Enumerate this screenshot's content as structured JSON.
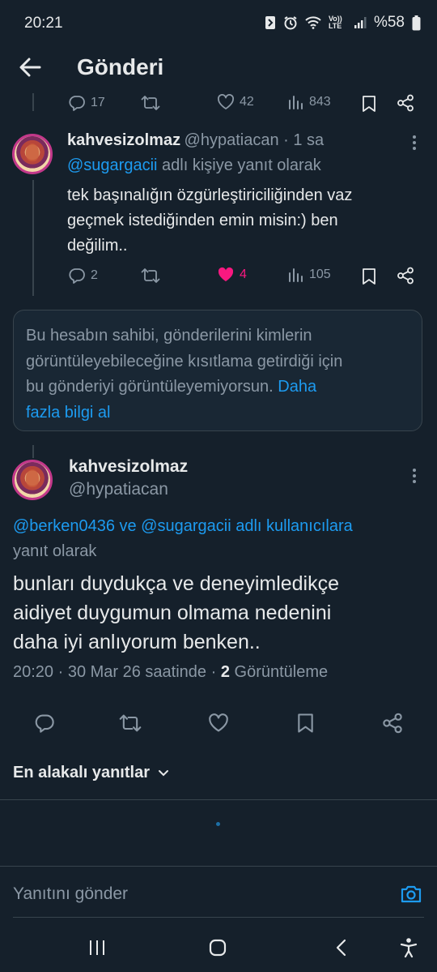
{
  "status_bar": {
    "time": "20:21",
    "battery": "%58",
    "volte": "Vo)) LTE"
  },
  "header": {
    "title": "Gönderi"
  },
  "prev_tweet_actions": {
    "replies": "17",
    "likes": "42",
    "views": "843"
  },
  "reply_tweet": {
    "display_name": "kahvesizolmaz",
    "handle_time": "@hypatiacan · 1 sa",
    "reply_mention": "@sugargacii",
    "reply_suffix": " adlı kişiye yanıt olarak",
    "text_line1": "tek başınalığın özgürleştiriciliğinden vaz",
    "text_line2": "geçmek istediğinden emin misin:) ben",
    "text_line3": "değilim..",
    "replies": "2",
    "likes": "4",
    "views": "105",
    "like_color": "#f91880"
  },
  "restricted_notice": {
    "line1": "Bu hesabın sahibi, gönderilerini kimlerin",
    "line2": "görüntüleyebileceğine kısıtlama getirdiği için",
    "line3": "bu gönderiyi görüntüleyemiyorsun.",
    "link_part1": "Daha",
    "link_part2": "fazla bilgi al"
  },
  "main_tweet": {
    "display_name": "kahvesizolmaz",
    "handle": "@hypatiacan",
    "reply_mentions": "@berken0436 ve @sugargacii adlı kullanıcılara",
    "reply_suffix": "yanıt olarak",
    "text_line1": "bunları duydukça ve deneyimledikçe",
    "text_line2": "aidiyet duygumun olmama nedenini",
    "text_line3": "daha iyi anlıyorum benken..",
    "timestamp": "20:20 · 30 Mar 26 saatinde · ",
    "view_count": "2",
    "view_label": " Görüntüleme"
  },
  "replies_sort": {
    "label": "En alakalı yanıtlar"
  },
  "reply_composer": {
    "placeholder": "Yanıtını gönder"
  },
  "colors": {
    "background": "#15202b",
    "accent": "#1d9bf0",
    "muted": "#8b98a5"
  }
}
